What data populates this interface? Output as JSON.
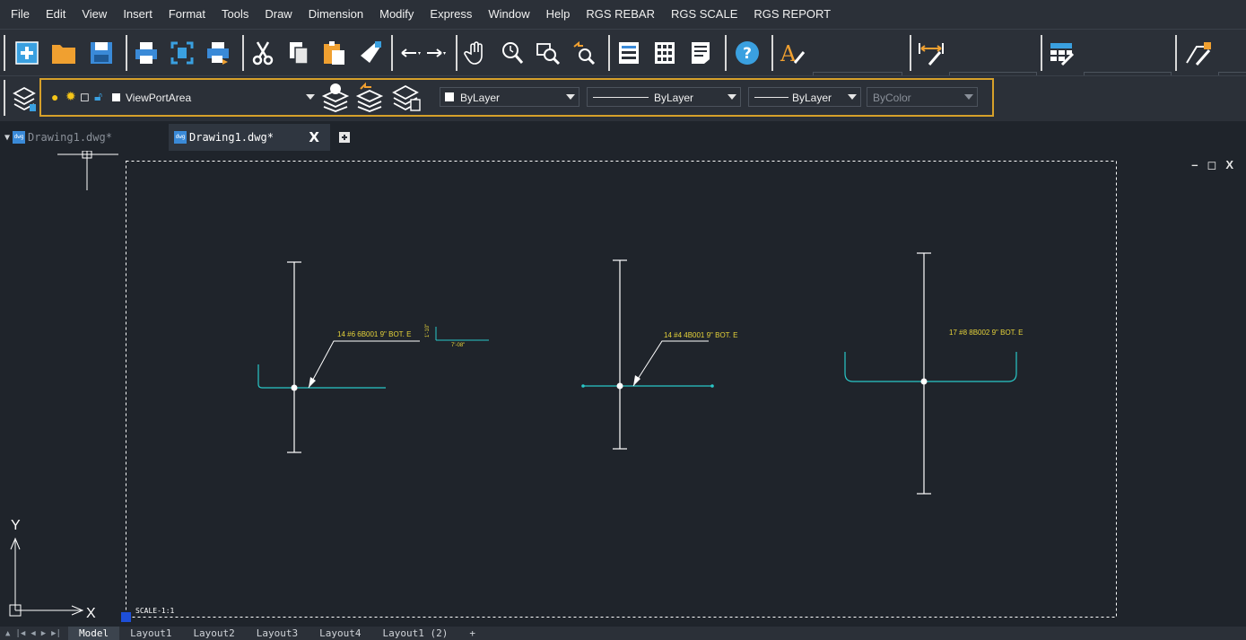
{
  "menu": [
    "File",
    "Edit",
    "View",
    "Insert",
    "Format",
    "Tools",
    "Draw",
    "Dimension",
    "Modify",
    "Express",
    "Window",
    "Help",
    "RGS REBAR",
    "RGS SCALE",
    "RGS REPORT"
  ],
  "toolbar": {
    "icons": [
      "new-file-icon",
      "open-folder-icon",
      "save-icon",
      "print-icon",
      "plot-preview-icon",
      "publish-icon",
      "cut-icon",
      "copy-icon",
      "paste-icon",
      "match-properties-icon",
      "undo-icon",
      "redo-icon",
      "pan-icon",
      "zoom-realtime-icon",
      "zoom-window-icon",
      "zoom-previous-icon",
      "properties-icon",
      "design-center-icon",
      "tool-palettes-icon",
      "help-icon",
      "text-style-icon",
      "dim-style-icon",
      "table-style-icon",
      "multileader-style-icon"
    ],
    "text_style_value": "",
    "dim_style_value": "",
    "table_style_value": ""
  },
  "layers": {
    "current_layer": "ViewPortArea",
    "color": "ByLayer",
    "linetype": "ByLayer",
    "lineweight": "ByLayer",
    "plot_style": "ByColor"
  },
  "doc_tabs": [
    {
      "label": "Drawing1.dwg*",
      "active": false
    },
    {
      "label": "Drawing1.dwg*",
      "active": true
    }
  ],
  "window_controls": {
    "minimize": "–",
    "restore": "◻",
    "close": "X"
  },
  "drawing": {
    "labels": [
      "14 #6 6B001 9\" BOT. E",
      "14 #4 4B001 9\" BOT. E",
      "17 #8 8B002 9\" BOT. E"
    ],
    "dim_small": "7'-08\"",
    "dim_vertical": "1'-10\"",
    "scale_text": "SCALE-1:1",
    "ucs_y": "Y",
    "ucs_x": "X"
  },
  "layout_tabs": [
    "Model",
    "Layout1",
    "Layout2",
    "Layout3",
    "Layout4",
    "Layout1 (2)",
    "+"
  ],
  "colors": {
    "accent": "#d6a02a",
    "cyan": "#29c8c8",
    "yellow": "#e6d33a",
    "white": "#ffffff",
    "bg": "#1f242b",
    "toolbar": "#2b3038"
  }
}
